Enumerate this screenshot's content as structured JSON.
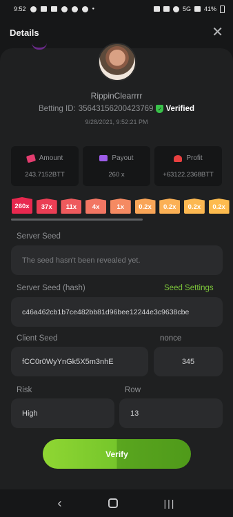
{
  "status_bar": {
    "time": "9:52",
    "network": "5G",
    "battery": "41%"
  },
  "header": {
    "title": "Details",
    "close_label": "✕"
  },
  "bet": {
    "username": "RippinClearrrr",
    "betting_id_label": "Betting ID:",
    "betting_id": "356431562004237​69",
    "verified_label": "Verified",
    "timestamp": "9/28/2021, 9:52:21 PM"
  },
  "stats": {
    "amount_label": "Amount",
    "amount_value": "243.7152BTT",
    "payout_label": "Payout",
    "payout_value": "260 x",
    "profit_label": "Profit",
    "profit_value": "+63122.2368BTT"
  },
  "multipliers": [
    {
      "label": "260x",
      "color": "#e8284f",
      "active": true
    },
    {
      "label": "37x",
      "color": "#ea3e55"
    },
    {
      "label": "11x",
      "color": "#ee5a5d"
    },
    {
      "label": "4x",
      "color": "#f27663"
    },
    {
      "label": "1x",
      "color": "#f58a62"
    },
    {
      "label": "0.2x",
      "color": "#f9a557"
    },
    {
      "label": "0.2x",
      "color": "#fbb055"
    },
    {
      "label": "0.2x",
      "color": "#fcb851"
    },
    {
      "label": "0.2x",
      "color": "#fdbb4e"
    }
  ],
  "form": {
    "server_seed_label": "Server Seed",
    "server_seed_placeholder": "The seed hasn't been revealed yet.",
    "server_seed_hash_label": "Server Seed (hash)",
    "seed_settings_label": "Seed Settings",
    "server_seed_hash_value": "c46a462cb1b7ce482bb81d96bee12244e3c9638cbe",
    "client_seed_label": "Client Seed",
    "client_seed_value": "fCC0r0WyYnGk5X5m3nhE",
    "nonce_label": "nonce",
    "nonce_value": "345",
    "risk_label": "Risk",
    "risk_value": "High",
    "row_label": "Row",
    "row_value": "13"
  },
  "verify_label": "Verify",
  "nav": {
    "back": "‹",
    "recents": "|||"
  }
}
